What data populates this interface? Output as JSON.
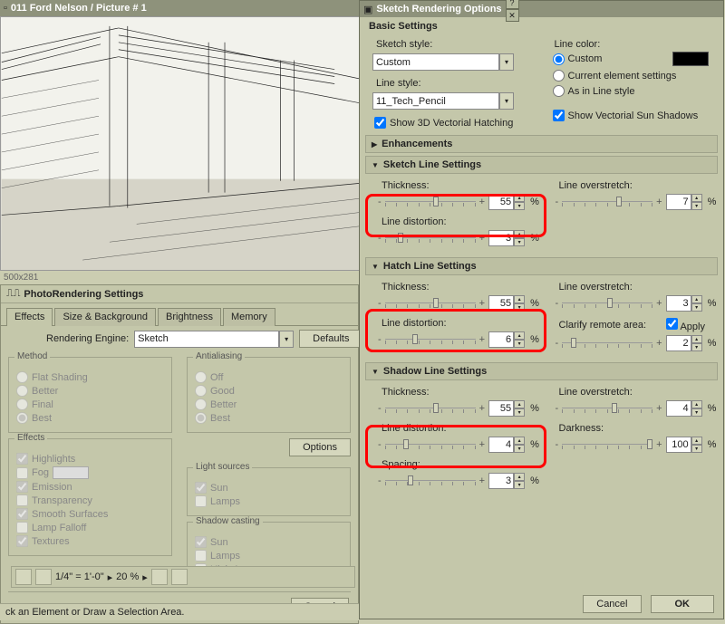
{
  "mainWindow": {
    "title": "011 Ford Nelson / Picture # 1",
    "dim": "500x281"
  },
  "photoPanel": {
    "title": "PhotoRendering Settings",
    "tabs": [
      "Effects",
      "Size & Background",
      "Brightness",
      "Memory"
    ],
    "engine_label": "Rendering Engine:",
    "engine": "Sketch",
    "method": {
      "title": "Method",
      "flat": "Flat Shading",
      "better": "Better",
      "final": "Final",
      "best": "Best"
    },
    "aa": {
      "title": "Antialiasing",
      "off": "Off",
      "good": "Good",
      "better": "Better",
      "best": "Best"
    },
    "effects": {
      "title": "Effects",
      "highlights": "Highlights",
      "fog": "Fog",
      "emission": "Emission",
      "transparency": "Transparency",
      "smooth": "Smooth Surfaces",
      "lamp": "Lamp Falloff",
      "textures": "Textures"
    },
    "lights": {
      "title": "Light sources",
      "sun": "Sun",
      "lamps": "Lamps"
    },
    "shadow": {
      "title": "Shadow casting",
      "sun": "Sun",
      "lamps": "Lamps",
      "high": "High Accuracy"
    },
    "defaults": "Defaults",
    "options": "Options",
    "cancel": "Cancel"
  },
  "dialog": {
    "title": "Sketch Rendering Options",
    "basic": {
      "title": "Basic Settings",
      "sketch_style_label": "Sketch style:",
      "sketch_style": "Custom",
      "line_style_label": "Line style:",
      "line_style": "11_Tech_Pencil",
      "show_hatch": "Show 3D Vectorial Hatching",
      "line_color_label": "Line color:",
      "lc_custom": "Custom",
      "lc_current": "Current element settings",
      "lc_as": "As in Line style",
      "show_sun": "Show Vectorial Sun Shadows"
    },
    "enhancements": "Enhancements",
    "sketch_line": {
      "title": "Sketch Line Settings",
      "thickness": "Thickness:",
      "thickness_val": "55",
      "overstretch": "Line overstretch:",
      "overstretch_val": "7",
      "distortion": "Line distortion:",
      "distortion_val": "3"
    },
    "hatch_line": {
      "title": "Hatch Line Settings",
      "thickness": "Thickness:",
      "thickness_val": "55",
      "overstretch": "Line overstretch:",
      "overstretch_val": "3",
      "distortion": "Line distortion:",
      "distortion_val": "6",
      "clarify": "Clarify remote area:",
      "clarify_val": "2",
      "apply": "Apply"
    },
    "shadow_line": {
      "title": "Shadow Line Settings",
      "thickness": "Thickness:",
      "thickness_val": "55",
      "overstretch": "Line overstretch:",
      "overstretch_val": "4",
      "distortion": "Line distortion:",
      "distortion_val": "4",
      "darkness": "Darkness:",
      "darkness_val": "100",
      "spacing": "Spacing:",
      "spacing_val": "3"
    },
    "cancel": "Cancel",
    "ok": "OK",
    "pct": "%"
  },
  "statusbar": "ck an Element or Draw a Selection Area.",
  "toolbar": {
    "scale": "1/4\"  =  1'-0\"",
    "zoom": "20 %"
  }
}
